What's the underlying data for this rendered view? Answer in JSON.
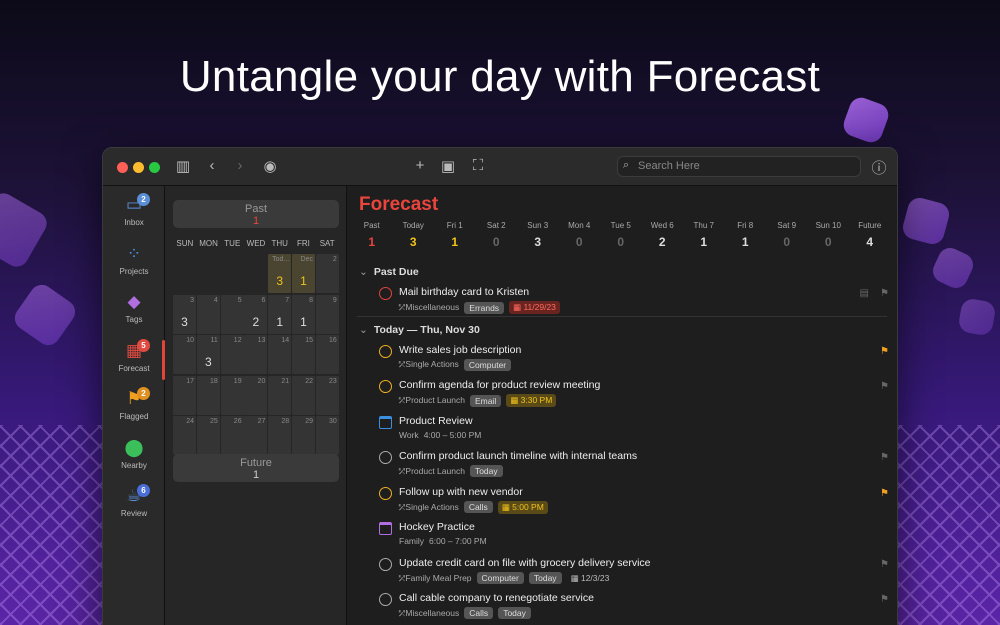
{
  "headline": "Untangle your day with Forecast",
  "search": {
    "placeholder": "Search Here"
  },
  "sidebar": [
    {
      "label": "Inbox",
      "icon": "inbox-icon",
      "badge": "2",
      "color": "#5a8fd8",
      "badgeColor": "#5a8fd8",
      "glyph": "▭"
    },
    {
      "label": "Projects",
      "icon": "projects-icon",
      "badge": "",
      "color": "#4a8fe0",
      "glyph": "⁘"
    },
    {
      "label": "Tags",
      "icon": "tag-icon",
      "badge": "",
      "color": "#b06ee0",
      "glyph": "◆"
    },
    {
      "label": "Forecast",
      "icon": "calendar-grid-icon",
      "badge": "5",
      "color": "#e04a40",
      "badgeColor": "#e04a40",
      "glyph": "▦"
    },
    {
      "label": "Flagged",
      "icon": "flag-icon",
      "badge": "2",
      "color": "#f0a020",
      "badgeColor": "#e09020",
      "glyph": "⚑"
    },
    {
      "label": "Nearby",
      "icon": "location-pin-icon",
      "badge": "",
      "color": "#3bbf5a",
      "glyph": "⬤"
    },
    {
      "label": "Review",
      "icon": "review-icon",
      "badge": "6",
      "color": "#5a8fd8",
      "badgeColor": "#4a6ed8",
      "glyph": "☕"
    }
  ],
  "calendar": {
    "past": {
      "label": "Past",
      "count": "1"
    },
    "future": {
      "label": "Future",
      "count": "1"
    },
    "dow": [
      "SUN",
      "MON",
      "TUE",
      "WED",
      "THU",
      "FRI",
      "SAT"
    ],
    "rows": [
      [
        {
          "d": ""
        },
        {
          "d": ""
        },
        {
          "d": ""
        },
        {
          "d": ""
        },
        {
          "d": "Tod...",
          "c": "3",
          "today": true
        },
        {
          "d": "Dec",
          "c": "1",
          "today": true
        },
        {
          "d": "2"
        }
      ],
      [
        {
          "d": "3",
          "c": "3"
        },
        {
          "d": "4"
        },
        {
          "d": "5"
        },
        {
          "d": "6",
          "c": "2"
        },
        {
          "d": "7",
          "c": "1"
        },
        {
          "d": "8",
          "c": "1"
        },
        {
          "d": "9"
        }
      ],
      [
        {
          "d": "10"
        },
        {
          "d": "11",
          "c": "3"
        },
        {
          "d": "12"
        },
        {
          "d": "13"
        },
        {
          "d": "14"
        },
        {
          "d": "15"
        },
        {
          "d": "16"
        }
      ],
      [
        {
          "d": "17"
        },
        {
          "d": "18"
        },
        {
          "d": "19"
        },
        {
          "d": "20"
        },
        {
          "d": "21"
        },
        {
          "d": "22"
        },
        {
          "d": "23"
        }
      ],
      [
        {
          "d": "24"
        },
        {
          "d": "25"
        },
        {
          "d": "26"
        },
        {
          "d": "27"
        },
        {
          "d": "28"
        },
        {
          "d": "29"
        },
        {
          "d": "30"
        }
      ]
    ]
  },
  "main": {
    "title": "Forecast",
    "strip": [
      {
        "label": "Past",
        "count": "1",
        "color": "#e8453c"
      },
      {
        "label": "Today",
        "count": "3",
        "color": "#f0c419"
      },
      {
        "label": "Fri 1",
        "count": "1",
        "color": "#f0c419"
      },
      {
        "label": "Sat 2",
        "count": "0",
        "color": "#666"
      },
      {
        "label": "Sun 3",
        "count": "3",
        "color": "#ddd"
      },
      {
        "label": "Mon 4",
        "count": "0",
        "color": "#666"
      },
      {
        "label": "Tue 5",
        "count": "0",
        "color": "#666"
      },
      {
        "label": "Wed 6",
        "count": "2",
        "color": "#ddd"
      },
      {
        "label": "Thu 7",
        "count": "1",
        "color": "#ddd"
      },
      {
        "label": "Fri 8",
        "count": "1",
        "color": "#ddd"
      },
      {
        "label": "Sat 9",
        "count": "0",
        "color": "#666"
      },
      {
        "label": "Sun 10",
        "count": "0",
        "color": "#666"
      },
      {
        "label": "Future",
        "count": "4",
        "color": "#ddd"
      }
    ],
    "sections": [
      {
        "title": "Past Due",
        "tasks": [
          {
            "title": "Mail birthday card to Kristen",
            "project": "Miscellaneous",
            "tags": [
              "Errands"
            ],
            "due": "11/29/23",
            "dueStyle": "overdue",
            "circle": "#e0443a",
            "flag": "none",
            "note": true
          }
        ]
      },
      {
        "title": "Today — Thu, Nov 30",
        "tasks": [
          {
            "title": "Write sales job description",
            "project": "Single Actions",
            "tags": [
              "Computer"
            ],
            "circle": "#f0b020",
            "flag": "on",
            "repeat": true
          },
          {
            "title": "Confirm agenda for product review meeting",
            "project": "Product Launch",
            "tags": [
              "Email"
            ],
            "due": "3:30 PM",
            "dueStyle": "today",
            "circle": "#f0b020",
            "flag": "off"
          },
          {
            "title": "Product Review",
            "event": true,
            "calendar": "Work",
            "time": "4:00 – 5:00 PM",
            "calColor": "#3a8fe0"
          },
          {
            "title": "Confirm product launch timeline with internal teams",
            "project": "Product Launch",
            "tags": [
              "Today"
            ],
            "circle": "#aaa",
            "flag": "off"
          },
          {
            "title": "Follow up with new vendor",
            "project": "Single Actions",
            "tags": [
              "Calls"
            ],
            "due": "5:00 PM",
            "dueStyle": "today",
            "circle": "#f0b020",
            "flag": "on",
            "repeat": true
          },
          {
            "title": "Hockey Practice",
            "event": true,
            "calendar": "Family",
            "time": "6:00 – 7:00 PM",
            "calColor": "#b06ee0"
          },
          {
            "title": "Update credit card on file with grocery delivery service",
            "project": "Family Meal Prep",
            "tags": [
              "Computer",
              "Today"
            ],
            "due": "12/3/23",
            "dueStyle": "plain",
            "circle": "#aaa",
            "flag": "off"
          },
          {
            "title": "Call cable company to renegotiate service",
            "project": "Miscellaneous",
            "tags": [
              "Calls",
              "Today"
            ],
            "circle": "#aaa",
            "flag": "off"
          }
        ]
      }
    ]
  }
}
